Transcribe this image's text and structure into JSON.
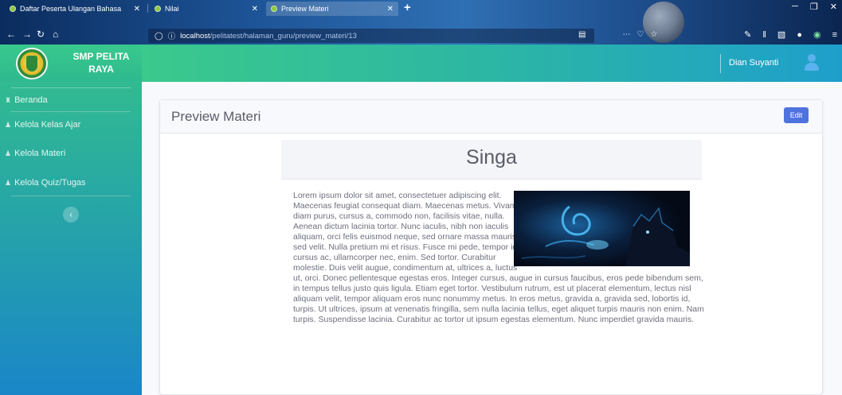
{
  "browser": {
    "tabs": [
      {
        "title": "Daftar Peserta Ulangan Bahasa",
        "close": "✕"
      },
      {
        "title": "Nilai",
        "close": "✕"
      },
      {
        "title": "Preview Materi",
        "close": "✕"
      }
    ],
    "new_tab": "+",
    "url_host": "localhost",
    "url_path": "/pelitatest/halaman_guru/preview_materi/13",
    "window_controls": [
      "─",
      "❐",
      "✕"
    ],
    "nav_icons": [
      "back-icon",
      "forward-icon",
      "reload-icon",
      "home-icon"
    ]
  },
  "sidebar": {
    "brand": "SMP PELITA RAYA",
    "items": [
      {
        "label": "Beranda",
        "icon": "home-icon"
      },
      {
        "label": "Kelola Kelas Ajar",
        "icon": "user-icon"
      },
      {
        "label": "Kelola Materi",
        "icon": "user-icon"
      },
      {
        "label": "Kelola Quiz/Tugas",
        "icon": "user-icon"
      }
    ],
    "collapse": "‹"
  },
  "topbar": {
    "user_name": "Dian Suyanti"
  },
  "card": {
    "title": "Preview Materi",
    "edit_label": "Edit"
  },
  "article": {
    "title": "Singa",
    "body": "Lorem ipsum dolor sit amet, consectetuer adipiscing elit. Maecenas feugiat consequat diam. Maecenas metus. Vivamus diam purus, cursus a, commodo non, facilisis vitae, nulla. Aenean dictum lacinia tortor. Nunc iaculis, nibh non iaculis aliquam, orci felis euismod neque, sed ornare massa mauris sed velit. Nulla pretium mi et risus. Fusce mi pede, tempor id, cursus ac, ullamcorper nec, enim. Sed tortor. Curabitur molestie. Duis velit augue, condimentum at, ultrices a, luctus ut, orci. Donec pellentesque egestas eros. Integer cursus, augue in cursus faucibus, eros pede bibendum sem, in tempus tellus justo quis ligula. Etiam eget tortor. Vestibulum rutrum, est ut placerat elementum, lectus nisl aliquam velit, tempor aliquam eros nunc nonummy metus. In eros metus, gravida a, gravida sed, lobortis id, turpis. Ut ultrices, ipsum at venenatis fringilla, sem nulla lacinia tellus, eget aliquet turpis mauris non enim. Nam turpis. Suspendisse lacinia. Curabitur ac tortor ut ipsum egestas elementum. Nunc imperdiet gravida mauris.",
    "image": "wolf-spirit-illustration"
  },
  "colors": {
    "sidebar_top": "#35c08b",
    "sidebar_bottom": "#1a86c8",
    "primary": "#4e73df",
    "text": "#6e707e"
  }
}
